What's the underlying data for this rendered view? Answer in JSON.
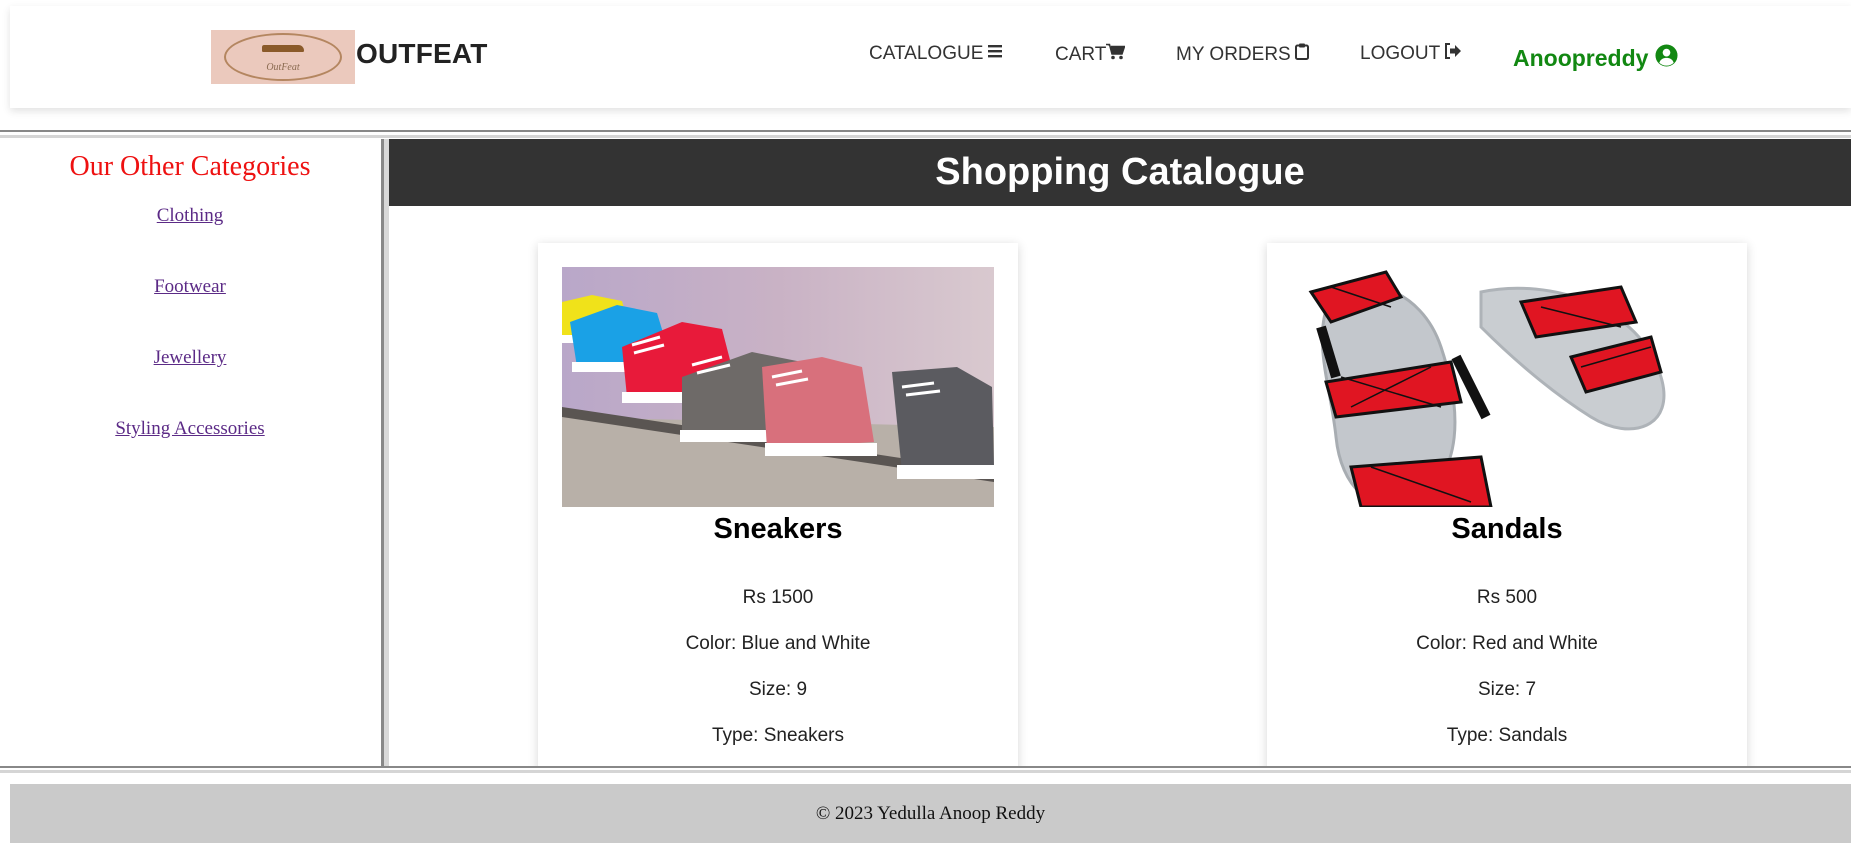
{
  "header": {
    "brand": "OUTFEAT",
    "logo_text": "OutFeat",
    "nav": {
      "catalogue": "CATALOGUE",
      "cart": "CART",
      "orders": "MY ORDERS",
      "logout": "LOGOUT"
    },
    "user": "Anoopreddy"
  },
  "sidebar": {
    "title": "Our Other Categories",
    "items": [
      "Clothing",
      "Footwear",
      "Jewellery",
      "Styling Accessories"
    ]
  },
  "main": {
    "title": "Shopping Catalogue",
    "products": [
      {
        "name": "Sneakers",
        "price": "Rs 1500",
        "color": "Color: Blue and White",
        "size": "Size: 9",
        "type": "Type: Sneakers"
      },
      {
        "name": "Sandals",
        "price": "Rs 500",
        "color": "Color: Red and White",
        "size": "Size: 7",
        "type": "Type: Sandals"
      }
    ]
  },
  "footer": {
    "text": "© 2023 Yedulla Anoop Reddy"
  },
  "colors": {
    "user_green": "#128812",
    "sidebar_title_red": "#ee1111",
    "link_purple": "#5b2a86",
    "catalogue_header_bg": "#333333",
    "footer_bg": "#cacaca"
  },
  "icons": {
    "catalogue": "bars-icon",
    "cart": "shopping-cart-icon",
    "orders": "clipboard-icon",
    "logout": "sign-out-icon",
    "user": "user-circle-icon"
  }
}
